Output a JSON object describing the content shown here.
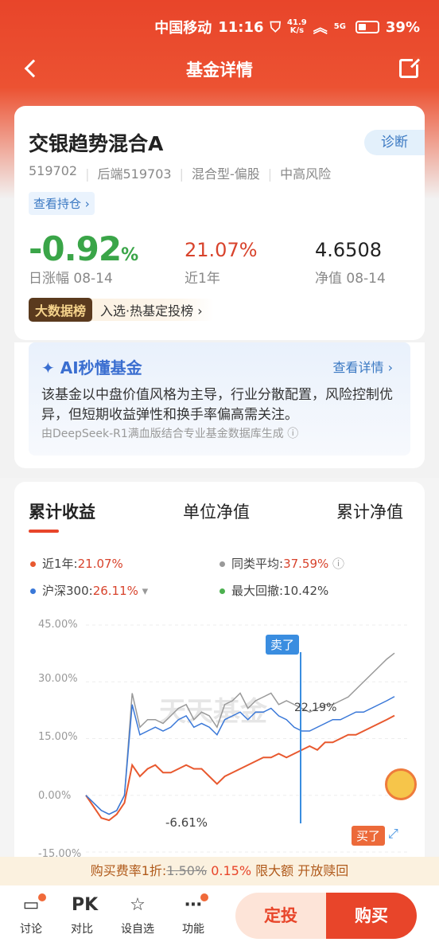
{
  "status": {
    "carrier": "中国移动",
    "time": "11:16",
    "speed_top": "41.9",
    "speed_bottom": "K/s",
    "net": "5G",
    "battery": "39%"
  },
  "nav": {
    "title": "基金详情"
  },
  "fund": {
    "name": "交银趋势混合A",
    "diagnose": "诊断",
    "code": "519702",
    "back_code": "后端519703",
    "type": "混合型-偏股",
    "risk": "中高风险",
    "holdings": "查看持仓 ›",
    "day_change": "-0.92",
    "day_change_unit": "%",
    "day_label": "日涨幅 08-14",
    "year_return": "21.07%",
    "year_label": "近1年",
    "nav_value": "4.6508",
    "nav_label": "净值 08-14",
    "rank_badge": "大数据榜",
    "rank_text": "入选·热基定投榜 ›"
  },
  "ai": {
    "title": "AI秒懂基金",
    "more": "查看详情 ›",
    "text": "该基金以中盘价值风格为主导，行业分散配置，风险控制优异，但短期收益弹性和换手率偏高需关注。",
    "source": "由DeepSeek-R1满血版结合专业基金数据库生成 ⓘ"
  },
  "chart_tabs": [
    "累计收益",
    "单位净值",
    "累计净值"
  ],
  "legend": [
    {
      "label": "近1年:",
      "value": "21.07%",
      "color": "#e8592f"
    },
    {
      "label": "同类平均:",
      "value": "37.59%",
      "color": "#999999"
    },
    {
      "label": "沪深300:",
      "value": "26.11%",
      "color": "#3a78d8"
    },
    {
      "label": "最大回撤:",
      "value": "10.42%",
      "color": "#4cb050"
    }
  ],
  "chart_data": {
    "type": "line",
    "yticks": [
      "45.00%",
      "30.00%",
      "15.00%",
      "0.00%",
      "-15.00%"
    ],
    "ylim": [
      -15,
      45
    ],
    "series": [
      {
        "name": "近1年",
        "color": "#e8592f",
        "values": [
          0,
          -3,
          -6,
          -6.6,
          -5,
          -2,
          8,
          5,
          7,
          8,
          6,
          6,
          7,
          8,
          7,
          7,
          5,
          3,
          5,
          6,
          7,
          8,
          9,
          10,
          10,
          11,
          10,
          11,
          12,
          13,
          12,
          14,
          14,
          15,
          16,
          16,
          17,
          18,
          19,
          20,
          21.07
        ]
      },
      {
        "name": "同类平均",
        "color": "#999999",
        "values": [
          0,
          -2,
          -4,
          -5,
          -4,
          0,
          27,
          18,
          20,
          20,
          19,
          21,
          23,
          24,
          20,
          22,
          21,
          18,
          24,
          25,
          27,
          23,
          25,
          26,
          27,
          24,
          25,
          24,
          23,
          22,
          23,
          24,
          24,
          25,
          26,
          28,
          30,
          32,
          34,
          36,
          37.59
        ]
      },
      {
        "name": "沪深300",
        "color": "#3a78d8",
        "values": [
          0,
          -2,
          -4,
          -5,
          -4,
          0,
          24,
          16,
          17,
          18,
          17,
          18,
          20,
          21,
          18,
          19,
          18,
          16,
          20,
          21,
          22,
          20,
          22,
          22,
          23,
          21,
          20,
          18,
          17,
          17,
          18,
          19,
          20,
          20,
          21,
          22,
          22,
          23,
          24,
          25,
          26.11
        ]
      }
    ],
    "annotations": {
      "sell": "卖了",
      "buy": "买了",
      "high": "22.19%",
      "low": "-6.61%"
    },
    "watermark": "天天基金"
  },
  "promo": {
    "prefix": "购买费率1折:",
    "old": "1.50%",
    "new": "0.15%",
    "suffix": "限大额 开放赎回"
  },
  "bottom": {
    "items": [
      "讨论",
      "对比",
      "设自选",
      "功能"
    ],
    "pk": "PK",
    "dingtou": "定投",
    "buy": "购买"
  }
}
